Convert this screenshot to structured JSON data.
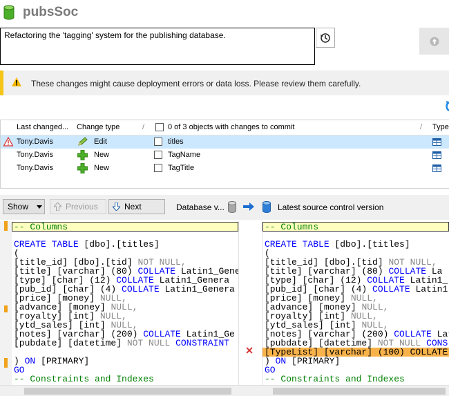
{
  "app": {
    "title": "pubsSoc"
  },
  "commit": {
    "message": "Refactoring the 'tagging' system for the publishing database."
  },
  "warning": {
    "text": "These changes might cause deployment errors or data loss. Please review them carefully."
  },
  "grid": {
    "headers": {
      "last_changed": "Last changed...",
      "change_type": "Change type",
      "objects": "0 of 3 objects with changes to commit",
      "type": "Type"
    },
    "rows": [
      {
        "user": "Tony.Davis",
        "change": "Edit",
        "object": "titles",
        "checked": false,
        "status": "error"
      },
      {
        "user": "Tony.Davis",
        "change": "New",
        "object": "TagName",
        "checked": false,
        "status": ""
      },
      {
        "user": "Tony.Davis",
        "change": "New",
        "object": "TagTitle",
        "checked": false,
        "status": ""
      }
    ]
  },
  "toolbar": {
    "show": "Show",
    "previous": "Previous",
    "next": "Next",
    "left_source": "Database v...",
    "right_source": "Latest source control version"
  },
  "diff": {
    "left": {
      "header": "-- Columns",
      "l1_kw": "CREATE TABLE",
      "l1": " [dbo].[titles]",
      "l2": "(",
      "l3a": "[title_id] [dbo].[tid] ",
      "l3b": "NOT NULL",
      "l4a": "[title] [varchar] (80) ",
      "l4b": "COLLATE",
      "l4c": " Latin1_Gener",
      "l5a": "[type] [char] (12) ",
      "l5b": "COLLATE",
      "l5c": " Latin1_Genera",
      "l6a": "[pub_id] [char] (4) ",
      "l6b": "COLLATE",
      "l6c": " Latin1_Genera",
      "l7a": "[price] [money] ",
      "l7b": "NULL",
      "l8a": "[advance] [money] ",
      "l8b": "NULL",
      "l9a": "[royalty] [int] ",
      "l9b": "NULL",
      "l10a": "[ytd_sales] [int] ",
      "l10b": "NULL",
      "l11a": "[notes] [varchar] (200) ",
      "l11b": "COLLATE",
      "l11c": " Latin1_Ge",
      "l12a": "[pubdate] [datetime] ",
      "l12b": "NOT NULL",
      "l12c": "CONSTRAINT",
      "l13a": ") ",
      "l13b": "ON",
      "l13c": " [PRIMARY]",
      "l14": "GO",
      "l15": "-- Constraints and Indexes"
    },
    "right": {
      "header": "-- Columns",
      "l1_kw": "CREATE TABLE",
      "l1": " [dbo].[titles]",
      "l2": "(",
      "l3a": "[title_id] [dbo].[tid] ",
      "l3b": "NOT NULL",
      "l4a": "[title] [varchar] (80) ",
      "l4b": "COLLATE",
      "l4c": " La",
      "l5a": "[type] [char] (12) ",
      "l5b": "COLLATE",
      "l5c": " Latin1_",
      "l6a": "[pub_id] [char] (4) ",
      "l6b": "COLLATE",
      "l6c": " Latin1",
      "l7a": "[price] [money] ",
      "l7b": "NULL",
      "l8a": "[advance] [money] ",
      "l8b": "NULL",
      "l9a": "[royalty] [int] ",
      "l9b": "NULL",
      "l10a": "[ytd_sales] [int] ",
      "l10b": "NULL",
      "l11a": "[notes] [varchar] (200) ",
      "l11b": "COLLATE",
      "l11c": " Lat",
      "l12a": "[pubdate] [datetime] ",
      "l12b": "NOT NULL",
      "l12c": "CONS",
      "l13": "[TypeList] [varchar] (100) COLLATE",
      "l14a": ") ",
      "l14b": "ON",
      "l14c": " [PRIMARY]",
      "l15": "GO",
      "l16": "-- Constraints and Indexes"
    }
  },
  "colors": {
    "warning_stripe": "#f5c518",
    "selected_row": "#cce8ff",
    "added_line": "#f8b24a",
    "keyword": "#0000ff"
  }
}
